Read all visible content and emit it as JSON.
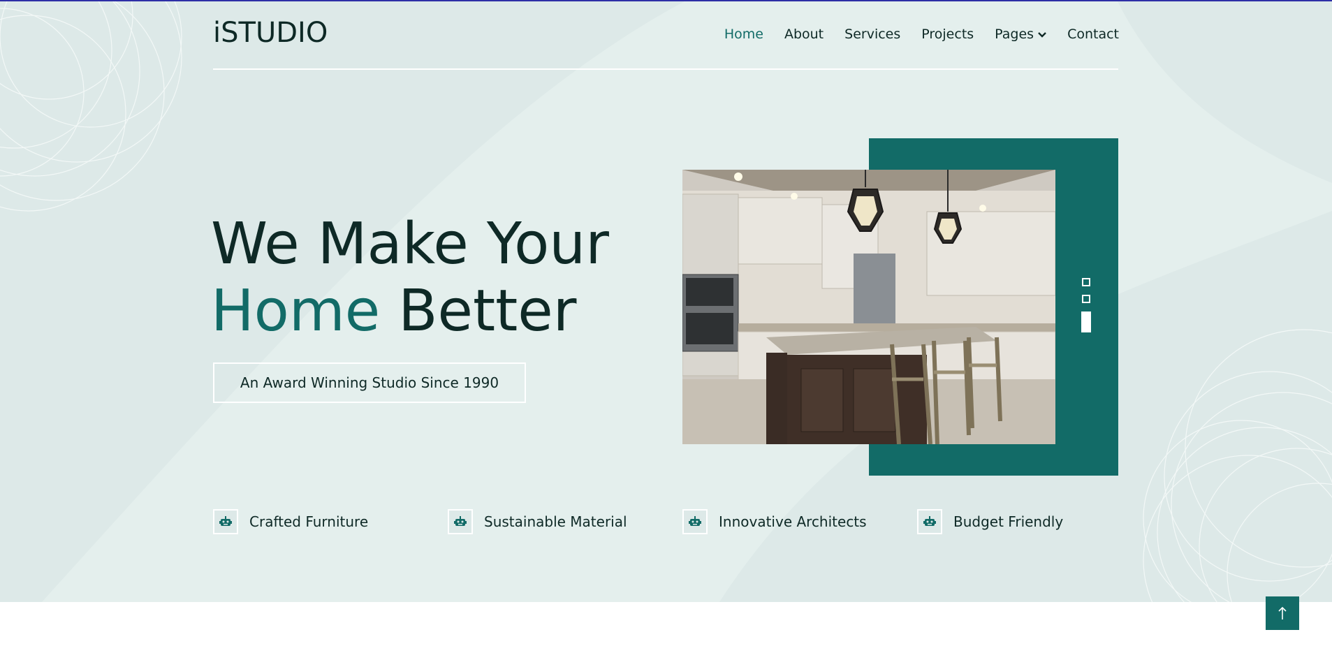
{
  "brand": {
    "logo": "iSTUDIO"
  },
  "nav": {
    "items": [
      {
        "label": "Home",
        "active": true
      },
      {
        "label": "About",
        "active": false
      },
      {
        "label": "Services",
        "active": false
      },
      {
        "label": "Projects",
        "active": false
      },
      {
        "label": "Pages",
        "active": false,
        "dropdown": true
      },
      {
        "label": "Contact",
        "active": false
      }
    ]
  },
  "hero": {
    "line1": "We Make Your",
    "line2_accent": "Home",
    "line2_rest": "Better",
    "award": "An Award Winning Studio Since 1990",
    "carousel": {
      "slides": 3,
      "active": 3
    }
  },
  "features": [
    {
      "label": "Crafted Furniture",
      "icon": "robot-icon"
    },
    {
      "label": "Sustainable Material",
      "icon": "robot-icon"
    },
    {
      "label": "Innovative Architects",
      "icon": "robot-icon"
    },
    {
      "label": "Budget Friendly",
      "icon": "robot-icon"
    }
  ],
  "colors": {
    "accent": "#126b67",
    "hero_bg": "#dde9e8",
    "text": "#0e2926",
    "topline": "#2d2fa6"
  },
  "back_to_top": {
    "icon": "arrow-up-icon"
  }
}
